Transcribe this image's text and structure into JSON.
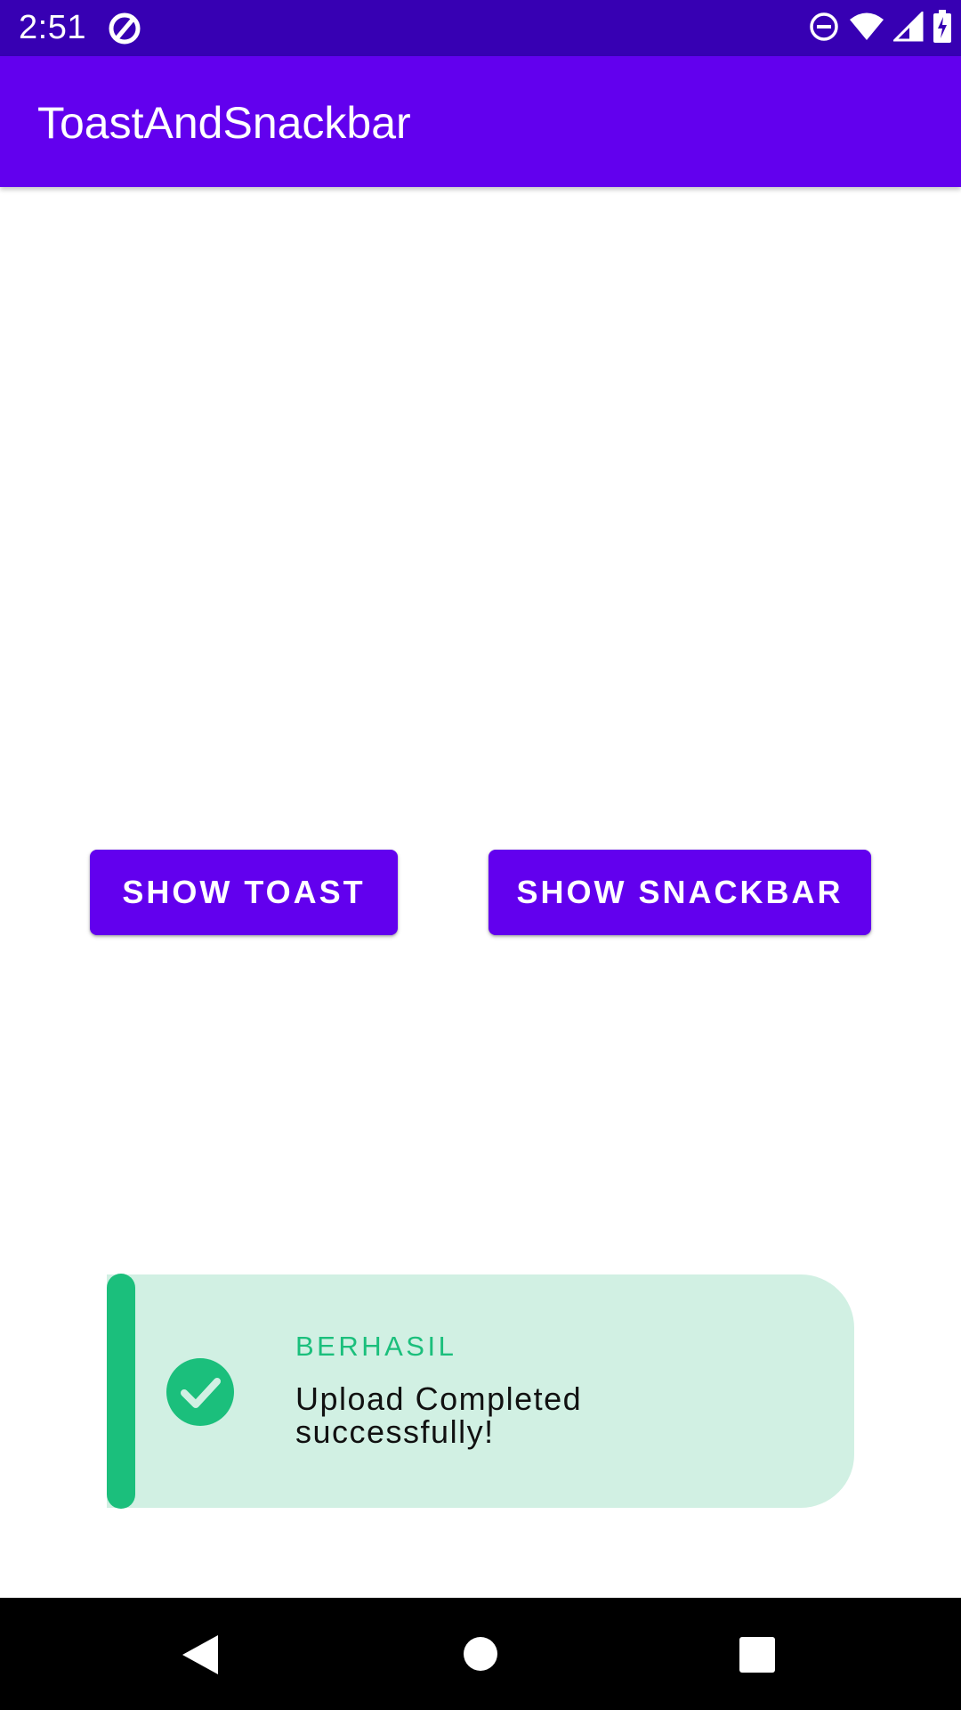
{
  "status_bar": {
    "time": "2:51",
    "left_icon": "data-saver-icon",
    "right_icons": [
      "do-not-disturb-icon",
      "wifi-icon",
      "cellular-signal-icon",
      "battery-charging-icon"
    ]
  },
  "app_bar": {
    "title": "ToastAndSnackbar"
  },
  "buttons": {
    "show_toast": "SHOW TOAST",
    "show_snackbar": "SHOW SNACKBAR"
  },
  "toast": {
    "title": "BERHASIL",
    "message": "Upload Completed successfully!",
    "icon": "check-circle-icon"
  },
  "nav_bar": {
    "icons": [
      "back-icon",
      "home-icon",
      "recents-icon"
    ]
  },
  "colors": {
    "status_bar": "#3700b3",
    "primary": "#6200ee",
    "success": "#1bbf7c",
    "success_background": "#d1f0e3"
  }
}
